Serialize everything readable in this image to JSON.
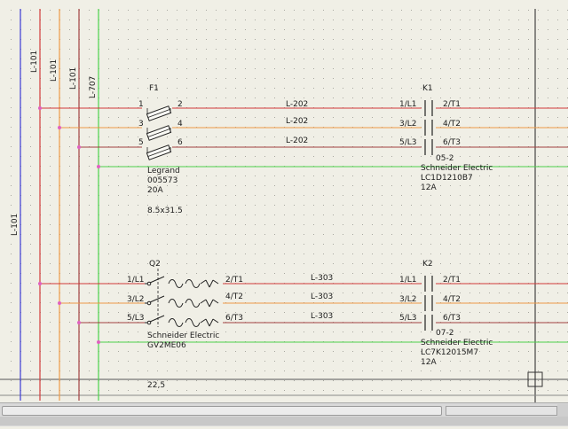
{
  "colors": {
    "background": "#f0efe6",
    "grid_dot": "#a8a8a0",
    "blue_wire": "#3b3bd6",
    "red_wire": "#d23a3a",
    "orange_wire": "#ee9a45",
    "dark_red_wire": "#a24040",
    "green_wire": "#4bd24b",
    "junction": "#e060c0"
  },
  "bus_labels": {
    "l1": "L-101",
    "l2": "L-101",
    "l3": "L-101",
    "pe": "L-707",
    "left_ref": "L-101"
  },
  "fuse": {
    "tag": "F1",
    "pins": [
      "1",
      "2",
      "3",
      "4",
      "5",
      "6"
    ],
    "maker": "Legrand",
    "part": "005573",
    "rating": "20A",
    "size": "8.5x31.5"
  },
  "wire_labels_top": [
    "L-202",
    "L-202",
    "L-202"
  ],
  "contactor_k1": {
    "tag": "K1",
    "in_pins": [
      "1/L1",
      "3/L2",
      "5/L3"
    ],
    "out_pins": [
      "2/T1",
      "4/T2",
      "6/T3"
    ],
    "ref": "05-2",
    "maker": "Schneider Electric",
    "part": "LC1D1210B7",
    "rating": "12A"
  },
  "breaker_q2": {
    "tag": "Q2",
    "in_pins": [
      "1/L1",
      "3/L2",
      "5/L3"
    ],
    "out_pins": [
      "2/T1",
      "4/T2",
      "6/T3"
    ],
    "maker": "Schneider Electric",
    "part": "GV2ME06"
  },
  "wire_labels_bottom": [
    "L-303",
    "L-303",
    "L-303"
  ],
  "contactor_k2": {
    "tag": "K2",
    "in_pins": [
      "1/L1",
      "3/L2",
      "5/L3"
    ],
    "out_pins": [
      "2/T1",
      "4/T2",
      "6/T3"
    ],
    "ref": "07-2",
    "maker": "Schneider Electric",
    "part": "LC7K12015M7",
    "rating": "12A"
  },
  "footer_value": "22,5"
}
